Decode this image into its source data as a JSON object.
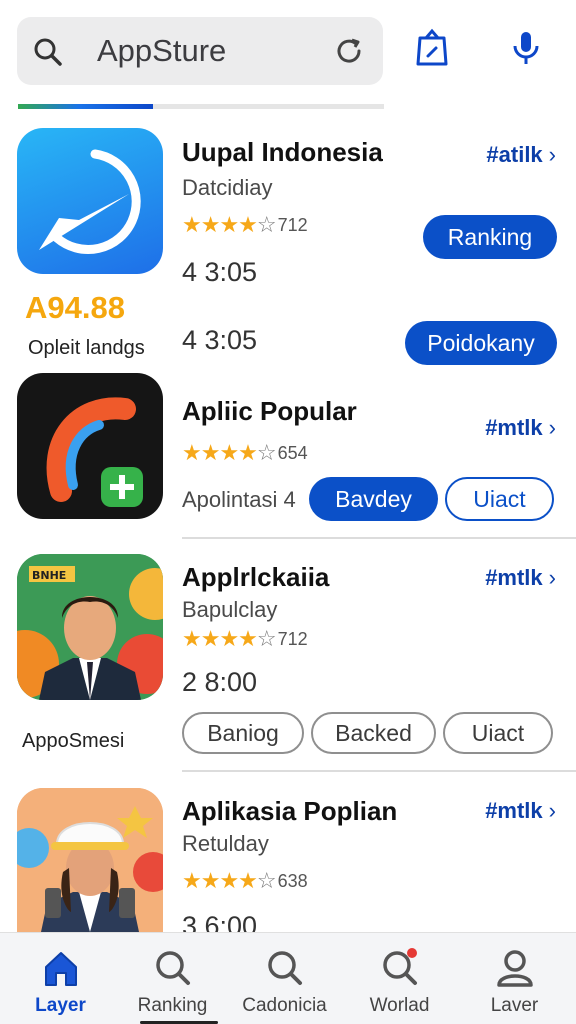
{
  "search": {
    "value": "AppSture"
  },
  "progress": {
    "fraction": 0.37
  },
  "apps": [
    {
      "title": "Uupal Indonesia",
      "subtitle": "Datcidiay",
      "rating_count": "712",
      "stars": 4,
      "time": "4 3:05",
      "time2": "4 3:05",
      "link": "#atilk",
      "button1": "Ranking",
      "button2": "Poidokany",
      "price": "A94.88",
      "caption": "Opleit landgs",
      "colors": {
        "icon_bg_top": "#29b6f6",
        "icon_bg_bottom": "#1e6fe8"
      }
    },
    {
      "title": "Apliic Popular",
      "rating_count": "654",
      "stars": 4,
      "subtitle": "Apolintasi 4",
      "link": "#mtlk",
      "button1": "Bavdey",
      "button2": "Uiact"
    },
    {
      "title": "Applrlckaiia",
      "subtitle": "Bapulclay",
      "rating_count": "712",
      "stars": 4,
      "time": "2 8:00",
      "link": "#mtlk",
      "button1": "Baniog",
      "button2": "Backed",
      "button3": "Uiact",
      "caption": "AppoSmesi",
      "badge": "BNHE"
    },
    {
      "title": "Aplikasia Poplian",
      "subtitle": "Retulday",
      "rating_count": "638",
      "stars": 4,
      "time": "3 6:00",
      "link": "#mtlk"
    }
  ],
  "nav": [
    {
      "label": "Layer",
      "icon": "home-icon",
      "active": true
    },
    {
      "label": "Ranking",
      "icon": "search-icon",
      "active": false
    },
    {
      "label": "Cadonicia",
      "icon": "search-icon",
      "active": false
    },
    {
      "label": "Worlad",
      "icon": "search-notification-icon",
      "active": false
    },
    {
      "label": "Laver",
      "icon": "person-icon",
      "active": false
    }
  ],
  "colors": {
    "accent": "#0b50c8",
    "star": "#f6a819",
    "price": "#f5a70e"
  }
}
